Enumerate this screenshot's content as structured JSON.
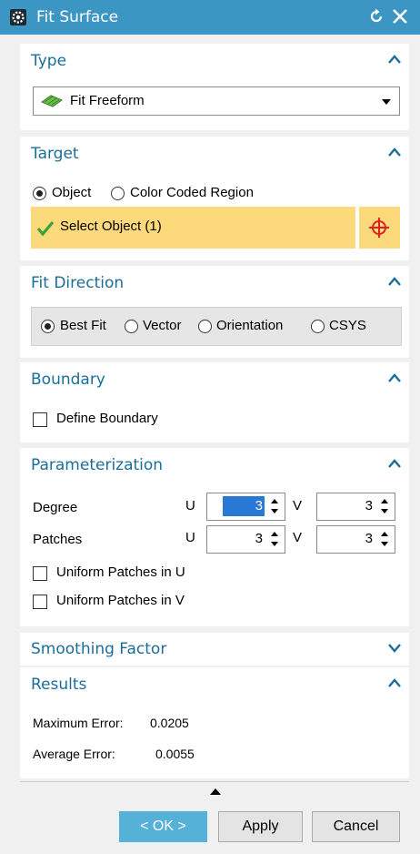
{
  "window": {
    "title": "Fit Surface",
    "title_icon": "gear-icon",
    "accent_color": "#3b96c4"
  },
  "type_group": {
    "title": "Type",
    "selected": "Fit Freeform",
    "selected_icon": "freeform-surface-icon"
  },
  "target_group": {
    "title": "Target",
    "options": [
      "Object",
      "Color Coded Region"
    ],
    "selected_option": "Object",
    "select_label": "Select Object (1)",
    "highlight_color": "#fcd97a"
  },
  "fit_direction_group": {
    "title": "Fit Direction",
    "options": [
      "Best Fit",
      "Vector",
      "Orientation",
      "CSYS"
    ],
    "selected_option": "Best Fit"
  },
  "boundary_group": {
    "title": "Boundary",
    "define_boundary_label": "Define Boundary",
    "define_boundary_checked": false
  },
  "parameterization_group": {
    "title": "Parameterization",
    "degree_label": "Degree",
    "patches_label": "Patches",
    "u_label": "U",
    "v_label": "V",
    "degree_u": "3",
    "degree_v": "3",
    "patches_u": "3",
    "patches_v": "3",
    "uniform_u_label": "Uniform Patches in U",
    "uniform_u_checked": false,
    "uniform_v_label": "Uniform Patches in V",
    "uniform_v_checked": false
  },
  "smoothing_group": {
    "title": "Smoothing Factor",
    "expanded": false
  },
  "results_group": {
    "title": "Results",
    "max_error_label": "Maximum Error:",
    "max_error_value": "0.0205",
    "avg_error_label": "Average Error:",
    "avg_error_value": "0.0055"
  },
  "buttons": {
    "ok": "< OK >",
    "apply": "Apply",
    "cancel": "Cancel"
  }
}
